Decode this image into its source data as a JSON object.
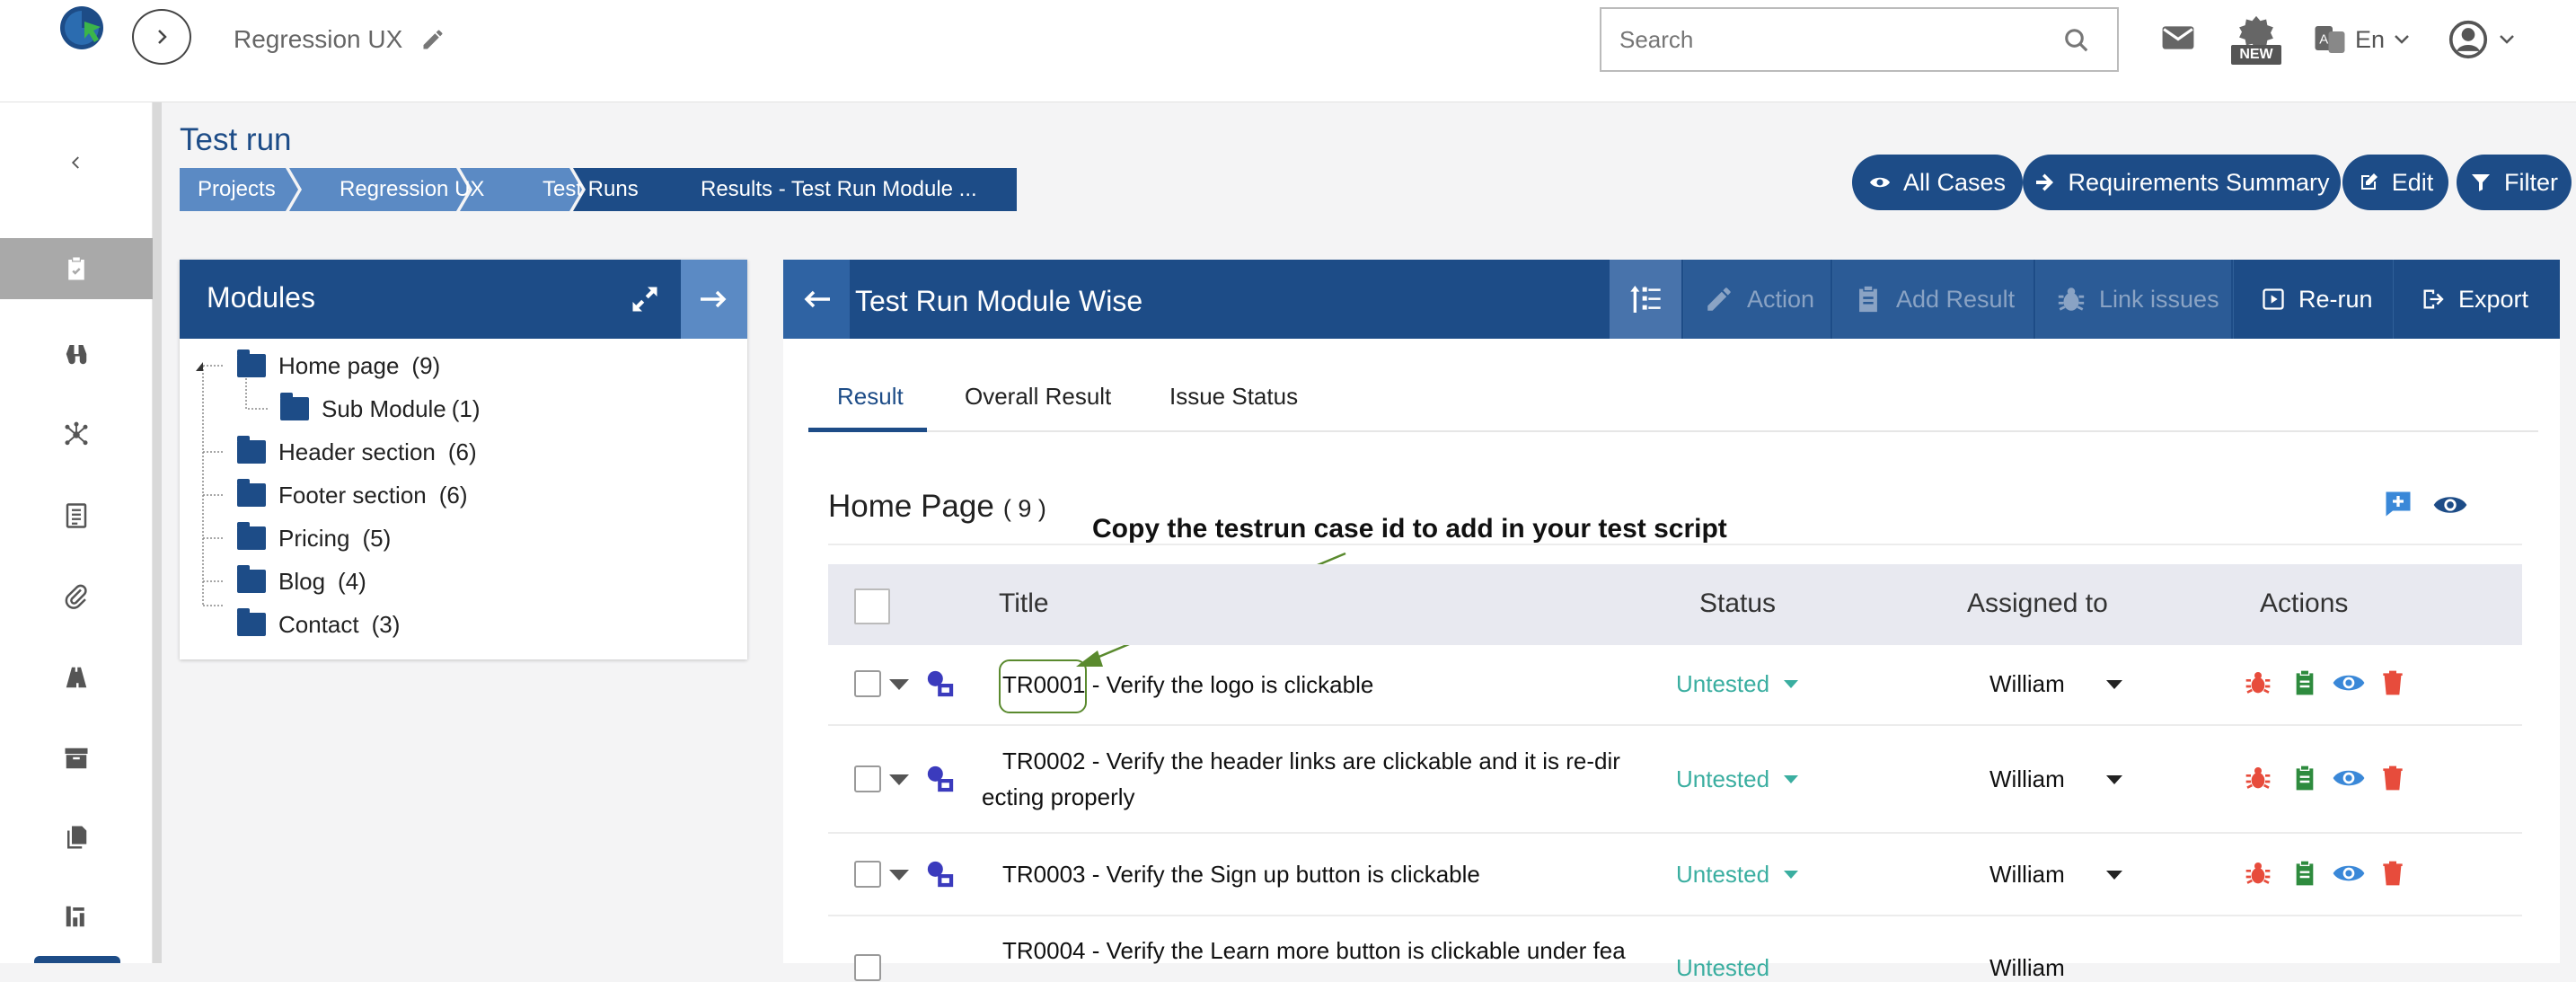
{
  "header": {
    "project_name": "Regression UX",
    "search_placeholder": "Search",
    "language": "En",
    "new_badge": "NEW"
  },
  "page": {
    "title": "Test run",
    "breadcrumbs": [
      "Projects",
      "Regression UX",
      "Test Runs",
      "Results - Test Run Module ..."
    ]
  },
  "top_actions": {
    "all_cases": "All Cases",
    "requirements_summary": "Requirements Summary",
    "edit": "Edit",
    "filter": "Filter"
  },
  "modules": {
    "title": "Modules",
    "tree": [
      {
        "name": "Home page",
        "count": "(9)"
      },
      {
        "name": "Sub Module",
        "count": "(1)"
      },
      {
        "name": "Header section",
        "count": "(6)"
      },
      {
        "name": "Footer section",
        "count": "(6)"
      },
      {
        "name": "Pricing",
        "count": "(5)"
      },
      {
        "name": "Blog",
        "count": "(4)"
      },
      {
        "name": "Contact",
        "count": "(3)"
      }
    ]
  },
  "panel": {
    "title": "Test Run Module Wise",
    "toolbar": {
      "action": "Action",
      "add_result": "Add Result",
      "link_issues": "Link issues",
      "rerun": "Re-run",
      "export": "Export"
    },
    "tabs": [
      "Result",
      "Overall Result",
      "Issue Status"
    ],
    "active_tab": "Result",
    "section_title": "Home Page",
    "section_count": "( 9 )",
    "annotation": "Copy the testrun case id to add in your test script",
    "columns": {
      "title": "Title",
      "status": "Status",
      "assigned": "Assigned to",
      "actions": "Actions"
    },
    "rows": [
      {
        "id": "TR0001",
        "title": " - Verify the logo is clickable",
        "title2": "",
        "status": "Untested",
        "assigned": "William"
      },
      {
        "id": "TR0002",
        "title": " - Verify the header links are clickable and it is re-dir",
        "title2": "ecting properly",
        "status": "Untested",
        "assigned": "William"
      },
      {
        "id": "TR0003",
        "title": " - Verify the Sign up button is clickable",
        "title2": "",
        "status": "Untested",
        "assigned": "William"
      },
      {
        "id": "TR0004",
        "title": " - Verify the Learn more button is clickable under fea",
        "title2": "",
        "status": "Untested",
        "assigned": "William"
      }
    ]
  },
  "colors": {
    "primary": "#1d4c87",
    "breadcrumb": "#5b8ac4",
    "status_untested": "#3aaea0",
    "annotation_green": "#5a8a2e",
    "bug_red": "#e74c3c",
    "clipboard_green": "#2e8b3e",
    "eye_blue": "#3a88d8",
    "trash_red": "#e74c3c"
  }
}
